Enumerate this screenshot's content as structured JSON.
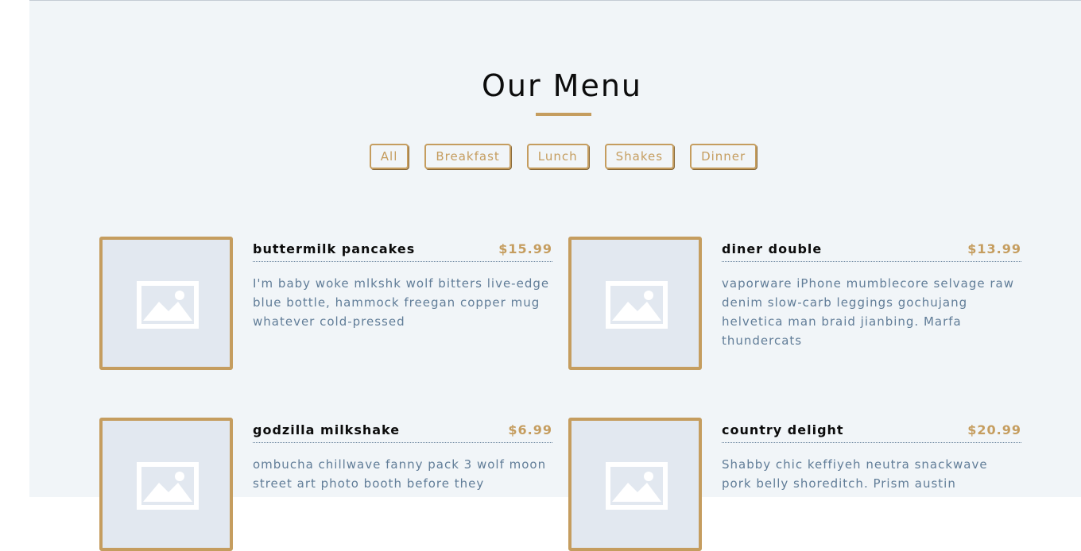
{
  "section": {
    "title": "Our Menu"
  },
  "filters": [
    {
      "label": "All"
    },
    {
      "label": "Breakfast"
    },
    {
      "label": "Lunch"
    },
    {
      "label": "Shakes"
    },
    {
      "label": "Dinner"
    }
  ],
  "items": [
    {
      "name": "buttermilk pancakes",
      "price": "$15.99",
      "desc": "I'm baby woke mlkshk wolf bitters live-edge blue bottle, hammock freegan copper mug whatever cold-pressed"
    },
    {
      "name": "diner double",
      "price": "$13.99",
      "desc": "vaporware iPhone mumblecore selvage raw denim slow-carb leggings gochujang helvetica man braid jianbing. Marfa thundercats"
    },
    {
      "name": "godzilla milkshake",
      "price": "$6.99",
      "desc": "ombucha chillwave fanny pack 3 wolf moon street art photo booth before they"
    },
    {
      "name": "country delight",
      "price": "$20.99",
      "desc": "Shabby chic keffiyeh neutra snackwave pork belly shoreditch. Prism austin"
    }
  ],
  "colors": {
    "accent": "#c59d5f",
    "background": "#f1f5f8",
    "text_muted": "#617d98",
    "placeholder": "#e2e8f0"
  },
  "icons": {
    "item_photo": "image-placeholder-icon"
  }
}
